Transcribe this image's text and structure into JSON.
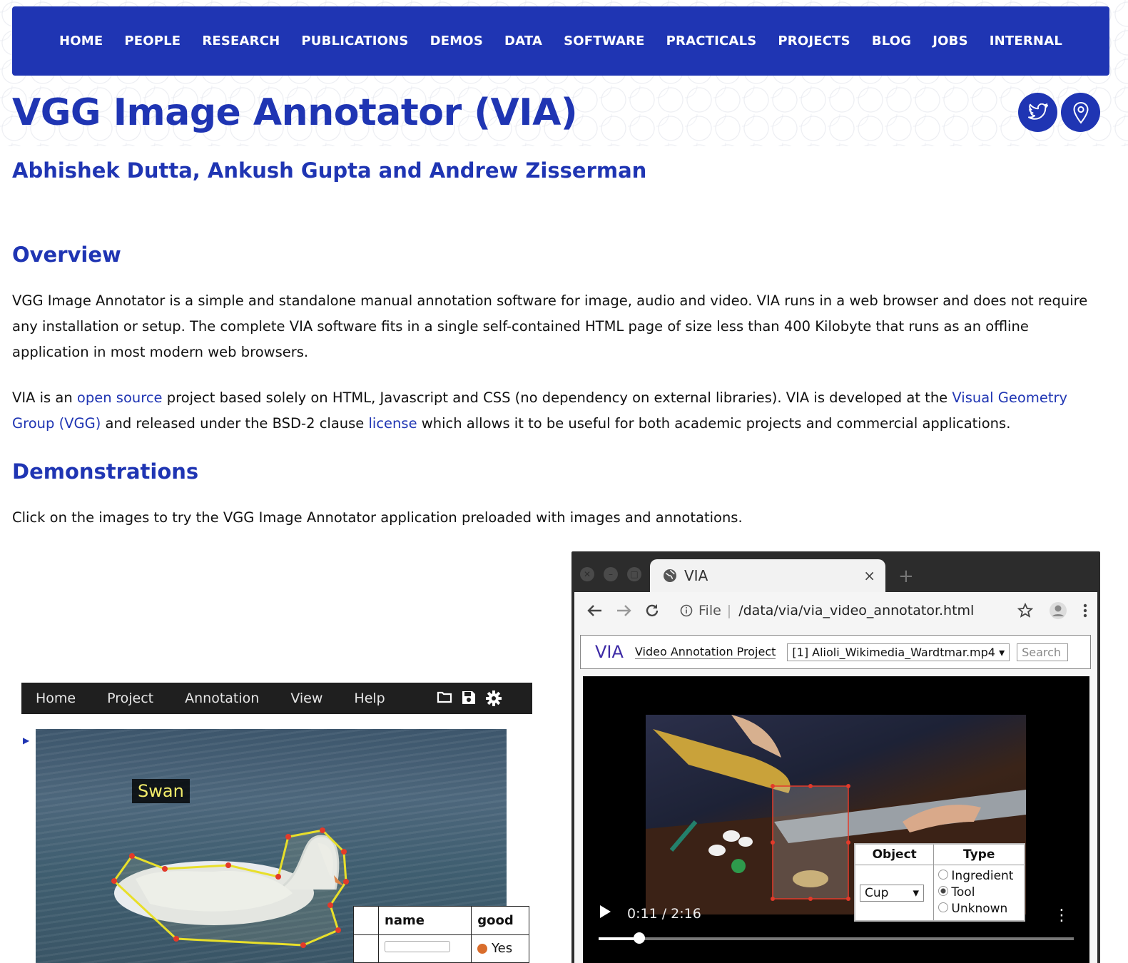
{
  "nav": {
    "items": [
      "HOME",
      "PEOPLE",
      "RESEARCH",
      "PUBLICATIONS",
      "DEMOS",
      "DATA",
      "SOFTWARE",
      "PRACTICALS",
      "PROJECTS",
      "BLOG",
      "JOBS",
      "INTERNAL"
    ]
  },
  "colors": {
    "brand": "#1f35b3"
  },
  "header": {
    "title": "VGG Image Annotator (VIA)",
    "social_icons": [
      "twitter-icon",
      "location-pin-icon"
    ]
  },
  "authors": "Abhishek Dutta, Ankush Gupta and Andrew Zisserman",
  "overview": {
    "heading": "Overview",
    "p1": "VGG Image Annotator is a simple and standalone manual annotation software for image, audio and video. VIA runs in a web browser and does not require any installation or setup. The complete VIA software fits in a single self-contained HTML page of size less than 400 Kilobyte that runs as an offline application in most modern web browsers.",
    "p2": {
      "t1": "VIA is an ",
      "link_open_source": "open source",
      "t2": " project based solely on HTML, Javascript and CSS (no dependency on external libraries). VIA is developed at the ",
      "link_vgg": "Visual Geometry Group (VGG)",
      "t3": " and released under the BSD-2 clause ",
      "link_license": "license",
      "t4": " which allows it to be useful for both academic projects and commercial applications."
    }
  },
  "demos": {
    "heading": "Demonstrations",
    "intro": "Click on the images to try the VGG Image Annotator application preloaded with images and annotations."
  },
  "image_demo": {
    "menu": [
      "Home",
      "Project",
      "Annotation",
      "View",
      "Help"
    ],
    "toolbar_icons": [
      "folder-icon",
      "save-icon",
      "gear-icon"
    ],
    "region_label": "Swan",
    "table": {
      "col1": "name",
      "col2": "good",
      "radio": "Yes"
    }
  },
  "video_demo": {
    "tab_title": "VIA",
    "tab_close": "×",
    "new_tab": "+",
    "addr_prefix": "File",
    "url": "/data/via/via_video_annotator.html",
    "via_logo": "VIA",
    "project_name": "Video Annotation Project",
    "file_selected": "[1] Alioli_Wikimedia_Wardtmar.mp4",
    "search_placeholder": "Search",
    "time": "0:11 / 2:16",
    "progress": 0.085,
    "table": {
      "col_object": "Object",
      "col_type": "Type",
      "object_value": "Cup",
      "type_options": [
        "Ingredient",
        "Tool",
        "Unknown"
      ],
      "type_selected": "Tool"
    }
  }
}
